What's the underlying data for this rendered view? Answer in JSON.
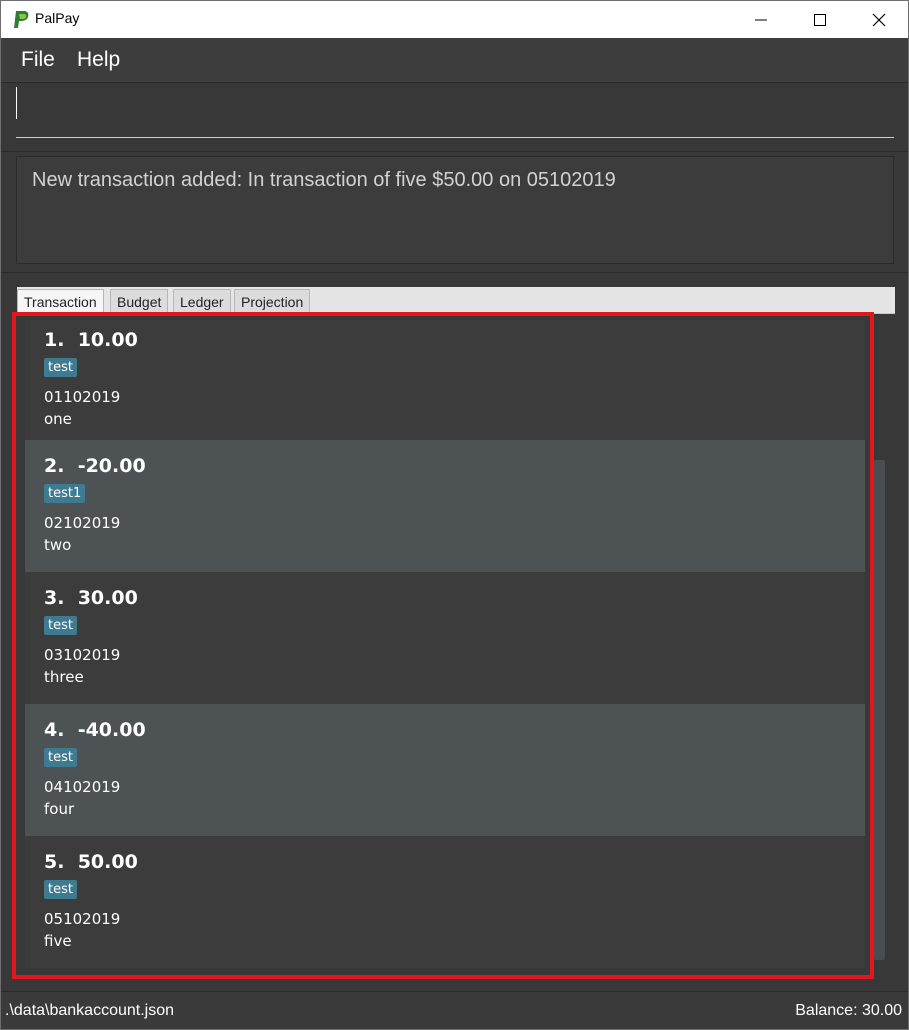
{
  "window": {
    "title": "PalPay",
    "icon": "palpay-logo-icon"
  },
  "menu": {
    "file": "File",
    "help": "Help"
  },
  "command": {
    "value": ""
  },
  "result": {
    "message": "New transaction added: In transaction of five $50.00 on 05102019"
  },
  "tabs": [
    {
      "label": "Transaction",
      "active": true
    },
    {
      "label": "Budget",
      "active": false
    },
    {
      "label": "Ledger",
      "active": false
    },
    {
      "label": "Projection",
      "active": false
    }
  ],
  "transactions": [
    {
      "index": "1.",
      "amount": "10.00",
      "tag": "test",
      "date": "01102019",
      "description": "one"
    },
    {
      "index": "2.",
      "amount": "-20.00",
      "tag": "test1",
      "date": "02102019",
      "description": "two"
    },
    {
      "index": "3.",
      "amount": "30.00",
      "tag": "test",
      "date": "03102019",
      "description": "three"
    },
    {
      "index": "4.",
      "amount": "-40.00",
      "tag": "test",
      "date": "04102019",
      "description": "four"
    },
    {
      "index": "5.",
      "amount": "50.00",
      "tag": "test",
      "date": "05102019",
      "description": "five"
    }
  ],
  "status": {
    "path": ".\\data\\bankaccount.json",
    "balance": "Balance: 30.00"
  },
  "colors": {
    "background": "#383838",
    "card_alt": "#4d5255",
    "tag": "#3e7b91",
    "highlight": "#e3161f"
  }
}
